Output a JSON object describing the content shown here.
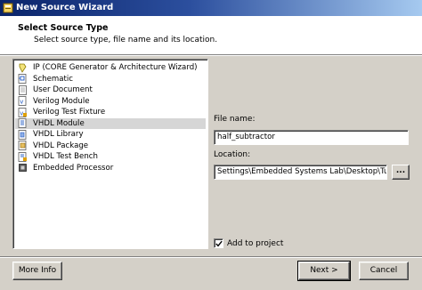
{
  "window": {
    "title": "New Source Wizard"
  },
  "header": {
    "title": "Select Source Type",
    "subtitle": "Select source type, file name and its location."
  },
  "source_types": [
    {
      "label": "IP (CORE Generator & Architecture Wizard)",
      "icon": "ip-core-icon",
      "selected": false
    },
    {
      "label": "Schematic",
      "icon": "schematic-icon",
      "selected": false
    },
    {
      "label": "User Document",
      "icon": "document-icon",
      "selected": false
    },
    {
      "label": "Verilog Module",
      "icon": "verilog-module-icon",
      "selected": false
    },
    {
      "label": "Verilog Test Fixture",
      "icon": "verilog-test-fixture-icon",
      "selected": false
    },
    {
      "label": "VHDL Module",
      "icon": "vhdl-module-icon",
      "selected": true
    },
    {
      "label": "VHDL Library",
      "icon": "vhdl-library-icon",
      "selected": false
    },
    {
      "label": "VHDL Package",
      "icon": "vhdl-package-icon",
      "selected": false
    },
    {
      "label": "VHDL Test Bench",
      "icon": "vhdl-test-bench-icon",
      "selected": false
    },
    {
      "label": "Embedded Processor",
      "icon": "embedded-processor-icon",
      "selected": false
    }
  ],
  "file_name": {
    "label": "File name:",
    "value": "half_subtractor"
  },
  "location": {
    "label": "Location:",
    "value": "Settings\\Embedded Systems Lab\\Desktop\\Tutorial",
    "browse_label": "..."
  },
  "add_to_project": {
    "label": "Add to project",
    "checked": true
  },
  "buttons": {
    "more_info": "More Info",
    "next": "Next >",
    "cancel": "Cancel"
  },
  "colors": {
    "title_bar": "#0a246a",
    "window_face": "#d4d0c8",
    "selection": "#d6d6d6"
  }
}
